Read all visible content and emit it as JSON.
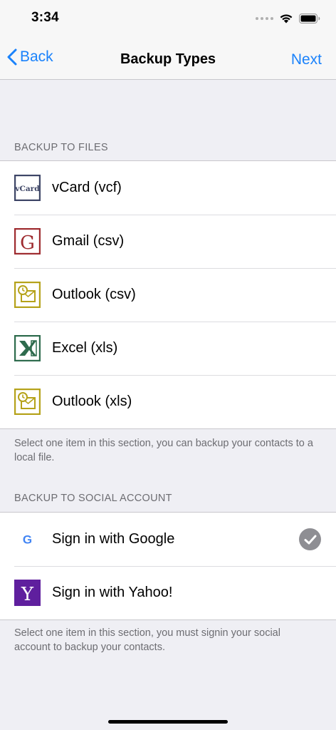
{
  "status": {
    "time": "3:34"
  },
  "nav": {
    "back_label": "Back",
    "title": "Backup Types",
    "next_label": "Next"
  },
  "files_section": {
    "header": "BACKUP TO FILES",
    "items": [
      {
        "label": "vCard (vcf)",
        "icon": "vcard-icon"
      },
      {
        "label": "Gmail (csv)",
        "icon": "gmail-icon"
      },
      {
        "label": "Outlook (csv)",
        "icon": "outlook-icon"
      },
      {
        "label": "Excel (xls)",
        "icon": "excel-icon"
      },
      {
        "label": "Outlook (xls)",
        "icon": "outlook-icon"
      }
    ],
    "footer": "Select one item in this section, you can backup your contacts to a local file."
  },
  "social_section": {
    "header": "BACKUP TO SOCIAL ACCOUNT",
    "items": [
      {
        "label": "Sign in with Google",
        "icon": "google-icon",
        "selected": true
      },
      {
        "label": "Sign in with Yahoo!",
        "icon": "yahoo-icon",
        "selected": false
      }
    ],
    "footer": "Select one item in this section, you must signin your social account to backup your contacts."
  },
  "icon_text": {
    "vcard": "vCard",
    "gmail": "G",
    "google": "G",
    "yahoo": "Y"
  },
  "colors": {
    "accent": "#1a82fb",
    "background": "#efeff4",
    "secondary_text": "#6d6d72",
    "check": "#8e8e93"
  }
}
